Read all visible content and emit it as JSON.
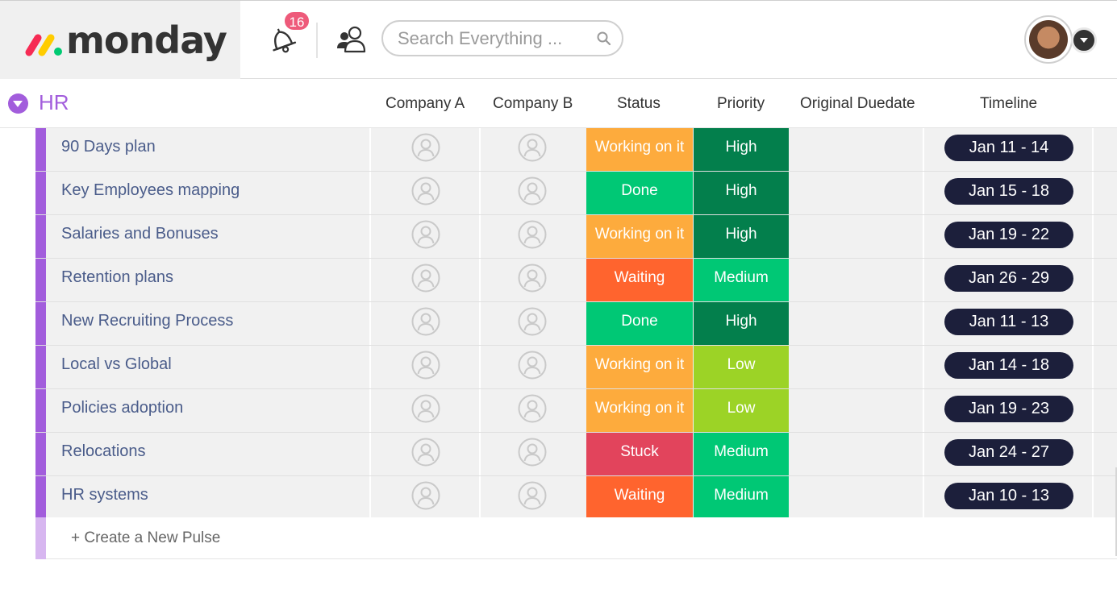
{
  "app": {
    "logo_text": "monday",
    "notifications_count": "16",
    "search_placeholder": "Search Everything ..."
  },
  "group": {
    "title": "HR",
    "color": "#a25ddc",
    "columns": [
      "Company A",
      "Company B",
      "Status",
      "Priority",
      "Original Duedate",
      "Timeline"
    ]
  },
  "rows": [
    {
      "name": "90 Days plan",
      "status": "Working on it",
      "status_color": "#fdab3d",
      "priority": "High",
      "priority_color": "#037f4c",
      "timeline": "Jan 11 - 14"
    },
    {
      "name": "Key Employees mapping",
      "status": "Done",
      "status_color": "#00c875",
      "priority": "High",
      "priority_color": "#037f4c",
      "timeline": "Jan 15 - 18"
    },
    {
      "name": "Salaries and Bonuses",
      "status": "Working on it",
      "status_color": "#fdab3d",
      "priority": "High",
      "priority_color": "#037f4c",
      "timeline": "Jan 19 - 22"
    },
    {
      "name": "Retention plans",
      "status": "Waiting",
      "status_color": "#ff642e",
      "priority": "Medium",
      "priority_color": "#00c875",
      "timeline": "Jan 26 - 29"
    },
    {
      "name": "New Recruiting Process",
      "status": "Done",
      "status_color": "#00c875",
      "priority": "High",
      "priority_color": "#037f4c",
      "timeline": "Jan 11 - 13"
    },
    {
      "name": "Local vs Global",
      "status": "Working on it",
      "status_color": "#fdab3d",
      "priority": "Low",
      "priority_color": "#9cd326",
      "timeline": "Jan 14 - 18"
    },
    {
      "name": "Policies adoption",
      "status": "Working on it",
      "status_color": "#fdab3d",
      "priority": "Low",
      "priority_color": "#9cd326",
      "timeline": "Jan 19 - 23"
    },
    {
      "name": "Relocations",
      "status": "Stuck",
      "status_color": "#e2445c",
      "priority": "Medium",
      "priority_color": "#00c875",
      "timeline": "Jan 24 - 27"
    },
    {
      "name": "HR systems",
      "status": "Waiting",
      "status_color": "#ff642e",
      "priority": "Medium",
      "priority_color": "#00c875",
      "timeline": "Jan 10 - 13"
    }
  ],
  "create_pulse_label": "+ Create a New Pulse"
}
